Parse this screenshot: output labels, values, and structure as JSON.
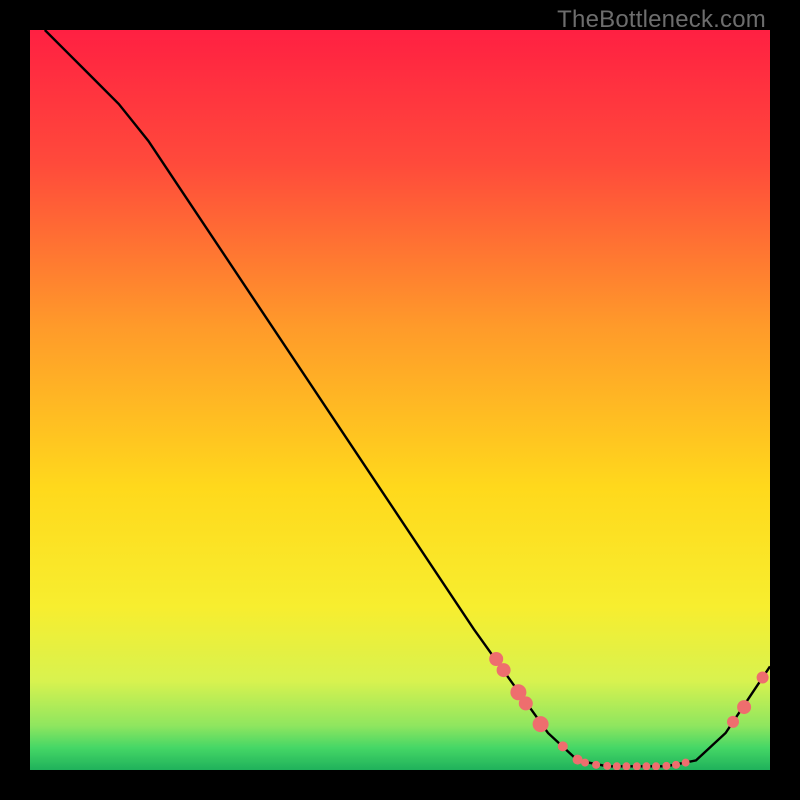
{
  "watermark": "TheBottleneck.com",
  "colors": {
    "bg": "#000000",
    "curve": "#000000",
    "marker": "#ee6e6e",
    "gradient_top": "#ff2042",
    "gradient_mid": "#ffea00",
    "gradient_green": "#2bdc6a",
    "gradient_bottom": "#1fa658"
  },
  "chart_data": {
    "type": "line",
    "title": "",
    "xlabel": "",
    "ylabel": "",
    "x_range": [
      0,
      100
    ],
    "y_range": [
      0,
      100
    ],
    "curve": [
      {
        "x": 2,
        "y": 100
      },
      {
        "x": 5,
        "y": 97
      },
      {
        "x": 8,
        "y": 94
      },
      {
        "x": 12,
        "y": 90
      },
      {
        "x": 16,
        "y": 85
      },
      {
        "x": 20,
        "y": 79
      },
      {
        "x": 30,
        "y": 64
      },
      {
        "x": 40,
        "y": 49
      },
      {
        "x": 50,
        "y": 34
      },
      {
        "x": 60,
        "y": 19
      },
      {
        "x": 65,
        "y": 12
      },
      {
        "x": 70,
        "y": 5
      },
      {
        "x": 74,
        "y": 1.3
      },
      {
        "x": 78,
        "y": 0.5
      },
      {
        "x": 82,
        "y": 0.5
      },
      {
        "x": 86,
        "y": 0.5
      },
      {
        "x": 90,
        "y": 1.3
      },
      {
        "x": 94,
        "y": 5
      },
      {
        "x": 98,
        "y": 11
      },
      {
        "x": 100,
        "y": 14
      }
    ],
    "markers_thick": [
      {
        "x": 63,
        "y": 15.0,
        "r": 7
      },
      {
        "x": 64,
        "y": 13.5,
        "r": 7
      },
      {
        "x": 66,
        "y": 10.5,
        "r": 8
      },
      {
        "x": 67,
        "y": 9.0,
        "r": 7
      },
      {
        "x": 69,
        "y": 6.2,
        "r": 8
      }
    ],
    "markers_small": [
      {
        "x": 72,
        "y": 3.2,
        "r": 5
      },
      {
        "x": 74,
        "y": 1.4,
        "r": 5
      },
      {
        "x": 75,
        "y": 1.0,
        "r": 4
      },
      {
        "x": 76.5,
        "y": 0.7,
        "r": 4
      },
      {
        "x": 78,
        "y": 0.55,
        "r": 4
      },
      {
        "x": 79.3,
        "y": 0.5,
        "r": 4
      },
      {
        "x": 80.6,
        "y": 0.5,
        "r": 4
      },
      {
        "x": 82,
        "y": 0.5,
        "r": 4
      },
      {
        "x": 83.3,
        "y": 0.5,
        "r": 4
      },
      {
        "x": 84.6,
        "y": 0.5,
        "r": 4
      },
      {
        "x": 86,
        "y": 0.55,
        "r": 4
      },
      {
        "x": 87.3,
        "y": 0.7,
        "r": 4
      },
      {
        "x": 88.6,
        "y": 1.0,
        "r": 4
      }
    ],
    "markers_right": [
      {
        "x": 95,
        "y": 6.5,
        "r": 6
      },
      {
        "x": 96.5,
        "y": 8.5,
        "r": 7
      },
      {
        "x": 99,
        "y": 12.5,
        "r": 6
      }
    ]
  }
}
